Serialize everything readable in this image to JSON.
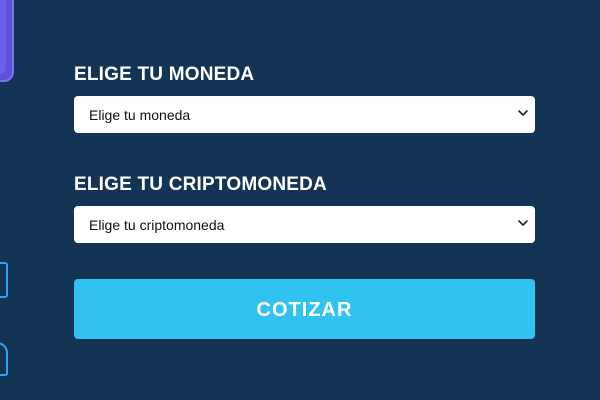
{
  "form": {
    "currency": {
      "label": "ELIGE TU MONEDA",
      "selected": "Elige tu moneda"
    },
    "crypto": {
      "label": "ELIGE TU CRIPTOMONEDA",
      "selected": "Elige tu criptomoneda"
    },
    "submit_label": "COTIZAR"
  },
  "icons": {
    "select_arrow": "chevron-down-icon"
  },
  "colors": {
    "background": "#143456",
    "button": "#31c3f0",
    "decoration_purple": "#5e51d8",
    "decoration_blue": "#2fa4ea"
  }
}
